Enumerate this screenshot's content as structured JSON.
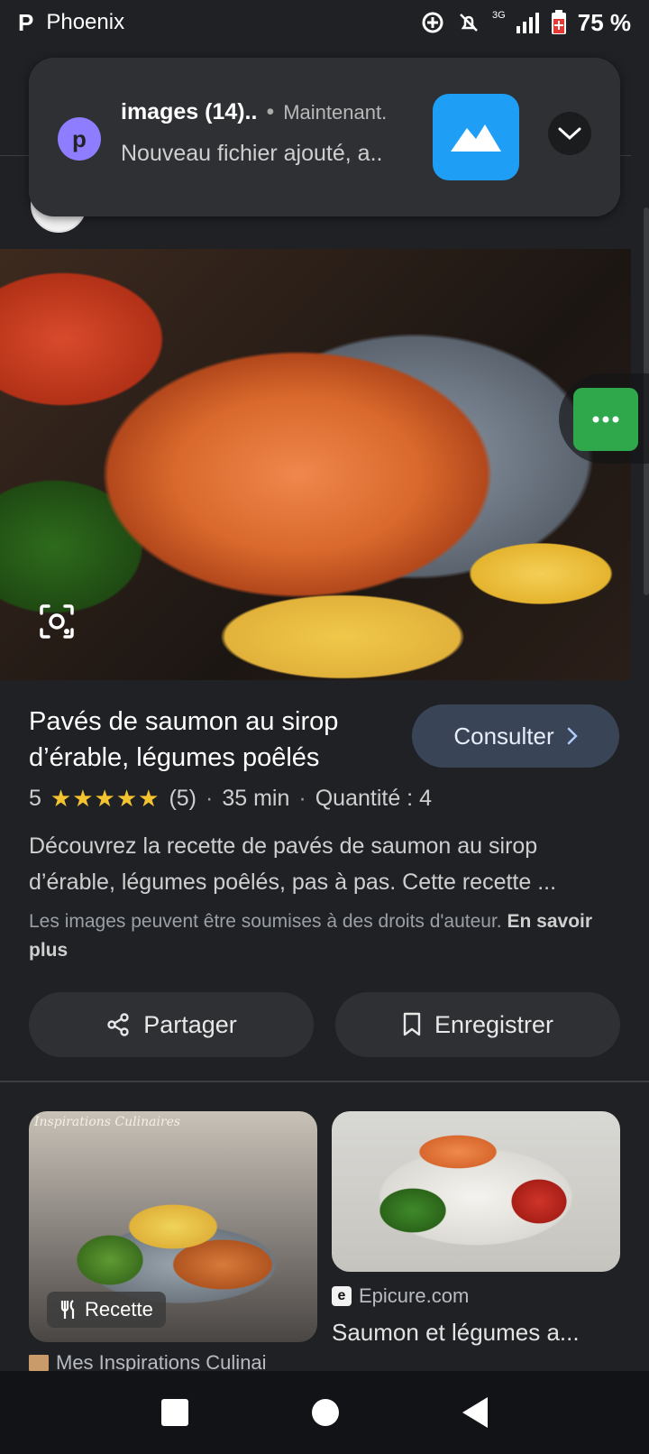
{
  "status_bar": {
    "app_name": "Phoenix",
    "network": "3G",
    "battery": "75 %"
  },
  "notification": {
    "title": "images (14)..",
    "separator": "•",
    "time": "Maintenant.",
    "body": "Nouveau fichier ajouté, a..",
    "app_icon_letter": "p"
  },
  "recipe": {
    "title": "Pavés de saumon au sirop d’érable, légumes poêlés",
    "consult_label": "Consulter",
    "rating_value": "5",
    "stars": "★★★★★",
    "rating_count": "(5)",
    "duration": "35 min",
    "quantity": "Quantité : 4",
    "description": "Découvrez la recette de pavés de saumon au sirop d’érable, légumes poêlés, pas à pas. Cette recette ...",
    "rights_text": "Les images peuvent être soumises à des droits d'auteur.",
    "rights_link": "En savoir plus"
  },
  "actions": {
    "share_label": "Partager",
    "save_label": "Enregistrer"
  },
  "related": [
    {
      "brand_overlay": "Inspirations Culinaires",
      "badge": "Recette",
      "source": "Mes Inspirations Culinai"
    },
    {
      "source": "Epicure.com",
      "source_icon_letter": "e",
      "title": "Saumon et légumes a..."
    }
  ],
  "colors": {
    "background": "#1f2125",
    "consult_button": "#394457",
    "star": "#f4c430",
    "fab": "#2ea84a",
    "notification_thumb": "#1e9ff5",
    "app_icon": "#8e7dff"
  }
}
